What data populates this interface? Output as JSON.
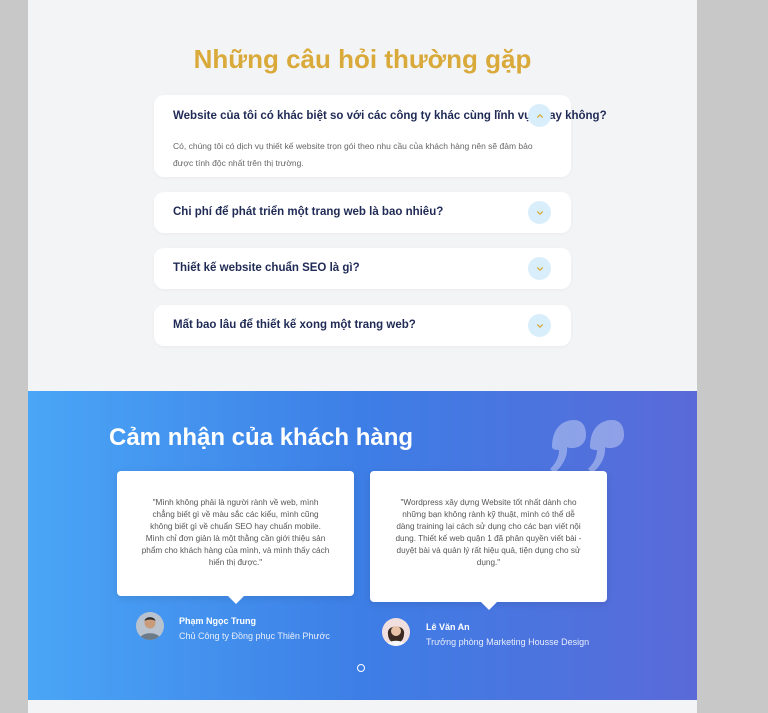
{
  "faq": {
    "title": "Những câu hỏi thường gặp",
    "items": [
      {
        "question": "Website của tôi có khác biệt so với các công ty khác cùng lĩnh vực hay không?",
        "answer": "Có, chúng tôi có dịch vụ thiết kế website trọn gói theo nhu cầu của khách hàng nên sẽ đảm bảo được tính độc nhất trên thị trường.",
        "expanded": true
      },
      {
        "question": "Chi phí để phát triển một trang web là bao nhiêu?",
        "expanded": false
      },
      {
        "question": "Thiết kế website chuẩn SEO là gì?",
        "expanded": false
      },
      {
        "question": "Mất bao lâu để thiết kế xong một trang web?",
        "expanded": false
      }
    ],
    "chevron_up_icon": "chevron-up-icon",
    "chevron_down_icon": "chevron-down-icon"
  },
  "testimonials": {
    "title": "Cảm nhận của khách hàng",
    "quote_icon": "quote-mark-icon",
    "items": [
      {
        "text": "\"Mình không phải là người rành về web, mình chẳng biết gì về màu sắc các kiểu, mình cũng không biết gì về chuẩn SEO hay chuẩn mobile. Mình chỉ đơn giản là một thằng cần giới thiệu sản phẩm cho khách hàng của mình, và mình thấy cách hiển thị được.\"",
        "name": "Phạm Ngọc Trung",
        "role": "Chủ Công ty Đồng phục Thiên Phước"
      },
      {
        "text": "\"Wordpress xây dựng Website tốt nhất dành cho những bạn không rành kỹ thuật, mình có thể dễ dàng training lại cách sử dụng cho các bạn viết nội dung. Thiết kế web quận 1 đã phân quyền viết bài - duyệt bài và quản lý rất hiệu quả, tiện dụng cho sử dụng.\"",
        "name": "Lê Văn An",
        "role": "Trưởng phòng Marketing Housse Design"
      }
    ],
    "pagination": {
      "current": 1,
      "total": 1
    }
  },
  "colors": {
    "faq_title": "#d9a93a",
    "question_text": "#1f2a55",
    "chevron_bg": "#d8eefb",
    "chevron_fg": "#d9a93a",
    "gradient_start": "#4aa6f6",
    "gradient_end": "#5a6ad8"
  }
}
